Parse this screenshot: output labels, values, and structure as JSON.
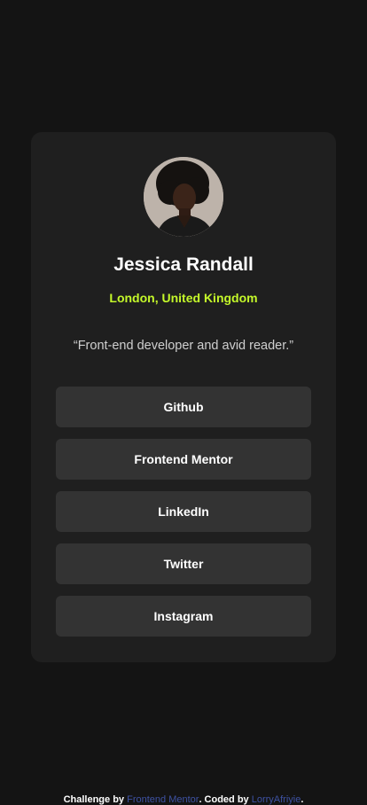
{
  "profile": {
    "name": "Jessica Randall",
    "location": "London, United Kingdom",
    "bio": "“Front-end developer and avid reader.”"
  },
  "links": [
    {
      "label": "Github"
    },
    {
      "label": "Frontend Mentor"
    },
    {
      "label": "LinkedIn"
    },
    {
      "label": "Twitter"
    },
    {
      "label": "Instagram"
    }
  ],
  "footer": {
    "challenge_prefix": "Challenge by ",
    "challenge_link": "Frontend Mentor",
    "coded_prefix": ". Coded by ",
    "coded_link": "LorryAfriyie",
    "suffix": "."
  },
  "colors": {
    "background": "#141414",
    "card": "#1f1f1f",
    "button": "#333333",
    "accent": "#c4f82a",
    "link": "#3e52a3"
  }
}
